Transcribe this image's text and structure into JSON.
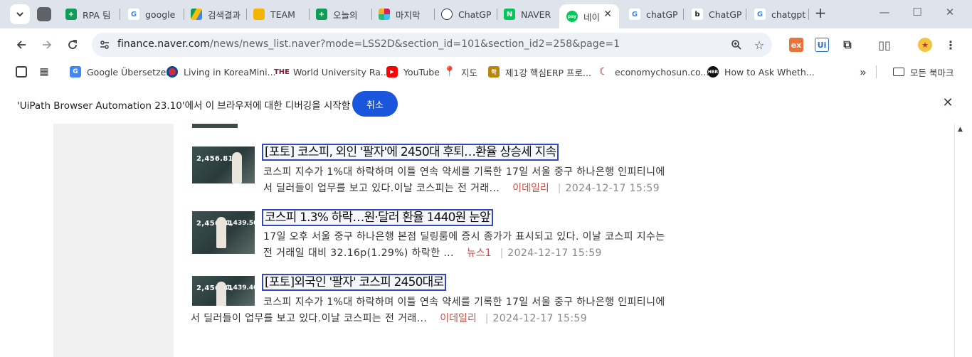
{
  "tabs": [
    {
      "title": "RPA 팀",
      "favicon": "sheets-icon",
      "color": "#0f9d58"
    },
    {
      "title": "google",
      "favicon": "google-icon",
      "color": "#4285f4"
    },
    {
      "title": "검색결과",
      "favicon": "drive-icon",
      "color": "#fbbc04"
    },
    {
      "title": "TEAM",
      "favicon": "slides-icon",
      "color": "#f4b400"
    },
    {
      "title": "오늘의",
      "favicon": "sheets-icon",
      "color": "#0f9d58"
    },
    {
      "title": "마지막",
      "favicon": "slack-icon",
      "color": "#e01e5a"
    },
    {
      "title": "ChatGP",
      "favicon": "openai-icon",
      "color": "#333333"
    },
    {
      "title": "NAVER",
      "favicon": "naver-icon",
      "color": "#03c75a"
    },
    {
      "title": "네이",
      "favicon": "naverpay-icon",
      "color": "#03c75a",
      "active": true
    },
    {
      "title": "chatGP",
      "favicon": "google-icon",
      "color": "#4285f4"
    },
    {
      "title": "ChatGP",
      "favicon": "bing-icon",
      "color": "#222222"
    },
    {
      "title": "chatgpt",
      "favicon": "google-icon",
      "color": "#4285f4"
    }
  ],
  "toolbar": {
    "url_host": "finance.naver.com",
    "url_rest": "/news/news_list.naver?mode=LSS2D&section_id=101&section_id2=258&page=1"
  },
  "bookmarks": [
    {
      "label": "Google Übersetzer",
      "icon": "translate-icon",
      "color": "#4285f4"
    },
    {
      "label": "Living in KoreaMini...",
      "icon": "korea-flag-icon",
      "color": "#cd2e3a"
    },
    {
      "label": "World University Ra...",
      "icon": "the-icon",
      "color": "#8b1d41"
    },
    {
      "label": "YouTube",
      "icon": "youtube-icon",
      "color": "#ff0000"
    },
    {
      "label": "지도",
      "icon": "maps-icon",
      "color": "#34a853"
    },
    {
      "label": "제1강 핵심ERP 프로...",
      "icon": "hak-icon",
      "color": "#b8860b"
    },
    {
      "label": "economychosun.co...",
      "icon": "chosun-icon",
      "color": "#d0021b"
    },
    {
      "label": "How to Ask Wheth...",
      "icon": "hbr-icon",
      "color": "#111111"
    }
  ],
  "bookmarks_all": "모든 북마크",
  "infobar": {
    "message": "'UiPath Browser Automation 23.10'에서 이 브라우저에 대한 디버깅을 시작함",
    "cancel_label": "취소"
  },
  "articles": [
    {
      "title": "[포토] 코스피, 외인 '팔자'에 2450대 후퇴…환율 상승세 지속",
      "summary_line1": "코스피 지수가 1%대 하락하며 이틀 연속 약세를 기록한 17일 서울 중구 하나은행 인피티니에",
      "summary_line2": "서 딜러들이 업무를 보고 있다.이날 코스피는 전 거래...",
      "press": "이데일리",
      "date": "2024-12-17 15:59",
      "thumb_num": "2,456.81"
    },
    {
      "title": "코스피 1.3% 하락…원·달러 환율 1440원 눈앞",
      "summary_line1": "17일 오후 서울 중구 하나은행 본점 딜링룸에 증시 종가가 표시되고 있다. 이날 코스피 지수는",
      "summary_line2": "전 거래일 대비 32.16p(1.29%) 하락한 ...",
      "press": "뉴스1",
      "date": "2024-12-17 15:59",
      "thumb_num": "2,456.81",
      "thumb_num2": "1,439.50"
    },
    {
      "title": "[포토]외국인 '팔자' 코스피 2450대로",
      "summary_line1": "코스피 지수가 1%대 하락하며 이틀 연속 약세를 기록한 17일 서울 중구 하나은행 인피티니에",
      "summary_line2": "서 딜러들이 업무를 보고 있다.이날 코스피는 전 거래...",
      "press": "이데일리",
      "date": "2024-12-17 15:59",
      "thumb_num": "2,456.81",
      "thumb_num2": "1,439.40"
    }
  ]
}
